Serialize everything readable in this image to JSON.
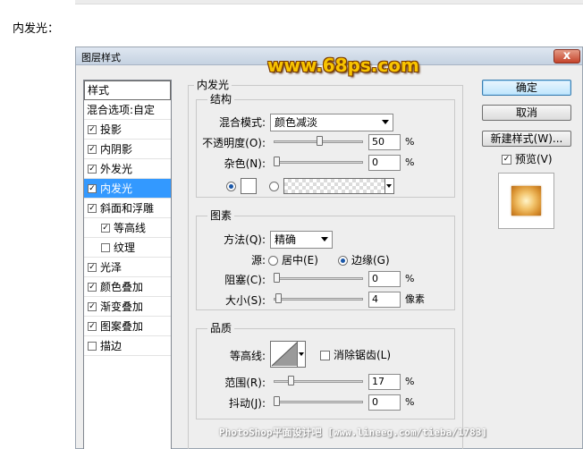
{
  "caption": "内发光：",
  "dialog": {
    "title": "图层样式",
    "watermark": "www.68ps.com",
    "close_glyph": "x"
  },
  "style_list": {
    "header": "样式",
    "blend_options": "混合选项:自定",
    "items": [
      {
        "label": "投影",
        "checked": true,
        "selected": false,
        "indent": false
      },
      {
        "label": "内阴影",
        "checked": true,
        "selected": false,
        "indent": false
      },
      {
        "label": "外发光",
        "checked": true,
        "selected": false,
        "indent": false
      },
      {
        "label": "内发光",
        "checked": true,
        "selected": true,
        "indent": false
      },
      {
        "label": "斜面和浮雕",
        "checked": true,
        "selected": false,
        "indent": false
      },
      {
        "label": "等高线",
        "checked": true,
        "selected": false,
        "indent": true
      },
      {
        "label": "纹理",
        "checked": false,
        "selected": false,
        "indent": true
      },
      {
        "label": "光泽",
        "checked": true,
        "selected": false,
        "indent": false
      },
      {
        "label": "颜色叠加",
        "checked": true,
        "selected": false,
        "indent": false
      },
      {
        "label": "渐变叠加",
        "checked": true,
        "selected": false,
        "indent": false
      },
      {
        "label": "图案叠加",
        "checked": true,
        "selected": false,
        "indent": false
      },
      {
        "label": "描边",
        "checked": false,
        "selected": false,
        "indent": false
      }
    ]
  },
  "panel": {
    "title": "内发光",
    "structure": {
      "legend": "结构",
      "blend_mode_label": "混合模式:",
      "blend_mode_value": "颜色减淡",
      "opacity_label": "不透明度(O):",
      "opacity_value": "50",
      "opacity_fraction": 0.5,
      "noise_label": "杂色(N):",
      "noise_value": "0",
      "noise_fraction": 0.0,
      "color_mode": "solid",
      "percent": "%"
    },
    "elements": {
      "legend": "图素",
      "method_label": "方法(Q):",
      "method_value": "精确",
      "source_label": "源:",
      "source_center": "居中(E)",
      "source_edge": "边缘(G)",
      "source_selected": "edge",
      "choke_label": "阻塞(C):",
      "choke_value": "0",
      "choke_fraction": 0.0,
      "size_label": "大小(S):",
      "size_value": "4",
      "size_fraction": 0.02,
      "percent": "%",
      "pixels": "像素"
    },
    "quality": {
      "legend": "品质",
      "contour_label": "等高线:",
      "anti_alias_label": "消除锯齿(L)",
      "anti_alias_checked": false,
      "range_label": "范围(R):",
      "range_value": "17",
      "range_fraction": 0.17,
      "jitter_label": "抖动(J):",
      "jitter_value": "0",
      "jitter_fraction": 0.0,
      "percent": "%"
    }
  },
  "buttons": {
    "ok": "确定",
    "cancel": "取消",
    "new_style": "新建样式(W)...",
    "preview_label": "预览(V)",
    "preview_checked": true
  },
  "footer_watermark": "PhotoShop平面设计吧 [www.lineeg.com/tieba/1783]",
  "colors": {
    "selection": "#3399ff",
    "watermark": "#f8c400",
    "glow_color": "#ffffff"
  }
}
